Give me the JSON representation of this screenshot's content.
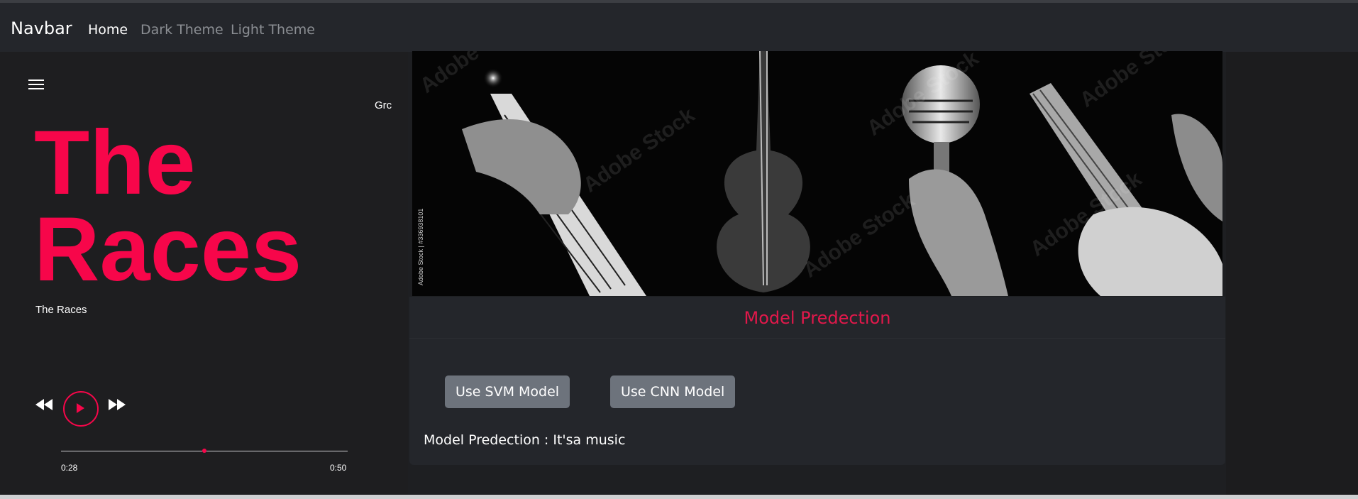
{
  "navbar": {
    "brand": "Navbar",
    "links": [
      {
        "label": "Home",
        "active": true
      },
      {
        "label": "Dark Theme",
        "active": false
      },
      {
        "label": "Light Theme",
        "active": false
      }
    ]
  },
  "player": {
    "clipped_text": "Grc",
    "title_large": "The Races",
    "title_small": "The Races",
    "current_time": "0:28",
    "total_time": "0:50",
    "progress_fraction": 0.5,
    "accent_color": "#f7064a",
    "icons": [
      "menu-icon",
      "rewind-icon",
      "play-icon",
      "fast-forward-icon"
    ]
  },
  "banner": {
    "watermark": "Adobe Stock",
    "stock_id": "Adobe Stock | #336938101"
  },
  "prediction": {
    "title": "Model Predection",
    "svm_button": "Use SVM Model",
    "cnn_button": "Use CNN Model",
    "result": "Model Predection : It'sa music"
  }
}
